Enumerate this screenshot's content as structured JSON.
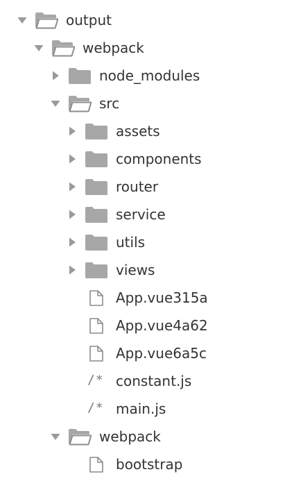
{
  "colors": {
    "text": "#333333",
    "icon": "#a7a7a7",
    "icon_stroke": "#8c8c8c",
    "arrow": "#9a9a9a",
    "background": "#ffffff"
  },
  "tree": [
    {
      "label": "output",
      "type": "folder",
      "expanded": true,
      "depth": 0,
      "icon": "folder-open-icon"
    },
    {
      "label": "webpack",
      "type": "folder",
      "expanded": true,
      "depth": 1,
      "icon": "folder-open-icon"
    },
    {
      "label": "node_modules",
      "type": "folder",
      "expanded": false,
      "depth": 2,
      "icon": "folder-icon"
    },
    {
      "label": "src",
      "type": "folder",
      "expanded": true,
      "depth": 2,
      "icon": "folder-open-icon"
    },
    {
      "label": "assets",
      "type": "folder",
      "expanded": false,
      "depth": 3,
      "icon": "folder-icon"
    },
    {
      "label": "components",
      "type": "folder",
      "expanded": false,
      "depth": 3,
      "icon": "folder-icon"
    },
    {
      "label": "router",
      "type": "folder",
      "expanded": false,
      "depth": 3,
      "icon": "folder-icon"
    },
    {
      "label": "service",
      "type": "folder",
      "expanded": false,
      "depth": 3,
      "icon": "folder-icon"
    },
    {
      "label": "utils",
      "type": "folder",
      "expanded": false,
      "depth": 3,
      "icon": "folder-icon"
    },
    {
      "label": "views",
      "type": "folder",
      "expanded": false,
      "depth": 3,
      "icon": "folder-icon"
    },
    {
      "label": "App.vue315a",
      "type": "file",
      "depth": 3,
      "icon": "file-icon"
    },
    {
      "label": "App.vue4a62",
      "type": "file",
      "depth": 3,
      "icon": "file-icon"
    },
    {
      "label": "App.vue6a5c",
      "type": "file",
      "depth": 3,
      "icon": "file-icon"
    },
    {
      "label": "constant.js",
      "type": "js",
      "depth": 3,
      "icon": "js-file-icon",
      "glyph": "/*"
    },
    {
      "label": "main.js",
      "type": "js",
      "depth": 3,
      "icon": "js-file-icon",
      "glyph": "/*"
    },
    {
      "label": "webpack",
      "type": "folder",
      "expanded": true,
      "depth": 2,
      "icon": "folder-open-icon"
    },
    {
      "label": "bootstrap",
      "type": "file",
      "depth": 3,
      "icon": "file-icon"
    }
  ]
}
